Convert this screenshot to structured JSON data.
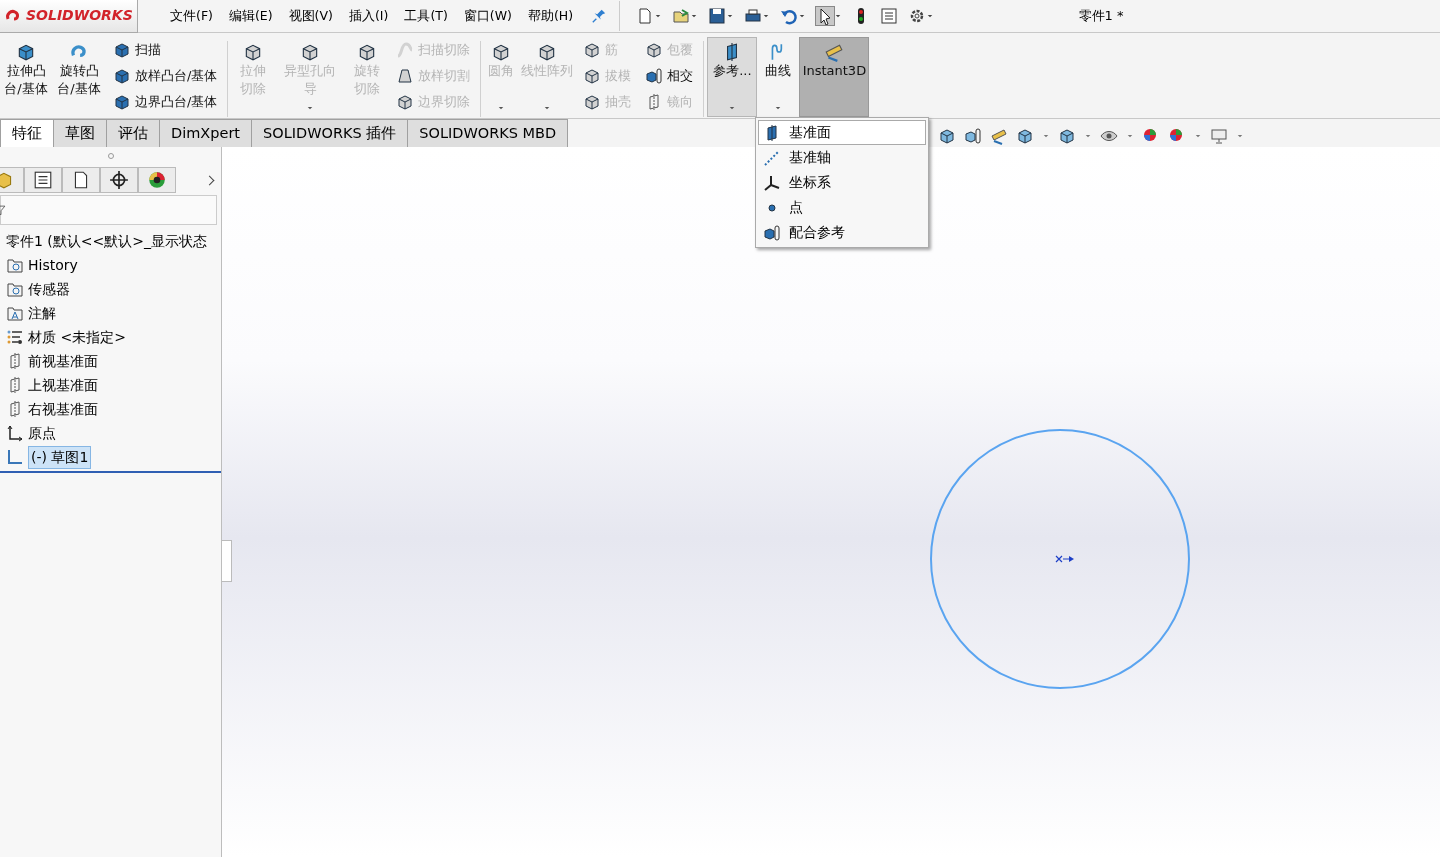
{
  "app": {
    "logo": "SOLIDWORKS",
    "title": "零件1 *"
  },
  "menu": [
    "文件(F)",
    "编辑(E)",
    "视图(V)",
    "插入(I)",
    "工具(T)",
    "窗口(W)",
    "帮助(H)"
  ],
  "ribbon": [
    {
      "kind": "large",
      "label": "拉伸凸台/基体",
      "disabled": false,
      "caret": false,
      "pressed": false
    },
    {
      "kind": "large",
      "label": "旋转凸台/基体",
      "disabled": false,
      "caret": false,
      "pressed": false
    },
    {
      "kind": "stack",
      "items": [
        {
          "label": "扫描",
          "disabled": false
        },
        {
          "label": "放样凸台/基体",
          "disabled": false
        },
        {
          "label": "边界凸台/基体",
          "disabled": false
        }
      ]
    },
    {
      "kind": "separator"
    },
    {
      "kind": "large",
      "label": "拉伸切除",
      "disabled": true,
      "caret": false,
      "pressed": false
    },
    {
      "kind": "large",
      "label": "异型孔向导",
      "disabled": true,
      "caret": true,
      "pressed": false
    },
    {
      "kind": "large",
      "label": "旋转切除",
      "disabled": true,
      "caret": false,
      "pressed": false
    },
    {
      "kind": "stack",
      "items": [
        {
          "label": "扫描切除",
          "disabled": true
        },
        {
          "label": "放样切割",
          "disabled": true
        },
        {
          "label": "边界切除",
          "disabled": true
        }
      ]
    },
    {
      "kind": "separator"
    },
    {
      "kind": "large",
      "label": "圆角",
      "disabled": true,
      "caret": true,
      "pressed": false
    },
    {
      "kind": "large",
      "label": "线性阵列",
      "disabled": true,
      "caret": true,
      "pressed": false
    },
    {
      "kind": "stack",
      "items": [
        {
          "label": "筋",
          "disabled": true
        },
        {
          "label": "拔模",
          "disabled": true
        },
        {
          "label": "抽壳",
          "disabled": true
        }
      ]
    },
    {
      "kind": "stack",
      "items": [
        {
          "label": "包覆",
          "disabled": true
        },
        {
          "label": "相交",
          "disabled": false
        },
        {
          "label": "镜向",
          "disabled": true
        }
      ]
    },
    {
      "kind": "separator"
    },
    {
      "kind": "large",
      "label": "参考...",
      "disabled": false,
      "caret": true,
      "pressed": true
    },
    {
      "kind": "large",
      "label": "曲线",
      "disabled": false,
      "caret": true,
      "pressed": false
    },
    {
      "kind": "large",
      "label": "Instant3D",
      "disabled": false,
      "caret": false,
      "pressed": true,
      "dark": true
    }
  ],
  "tabs": [
    {
      "label": "特征",
      "selected": true
    },
    {
      "label": "草图",
      "selected": false
    },
    {
      "label": "评估",
      "selected": false
    },
    {
      "label": "DimXpert",
      "selected": false
    },
    {
      "label": "SOLIDWORKS 插件",
      "selected": false
    },
    {
      "label": "SOLIDWORKS MBD",
      "selected": false
    }
  ],
  "tree": {
    "root": "零件1 (默认<<默认>_显示状态",
    "items": [
      {
        "label": "History",
        "selected": false
      },
      {
        "label": "传感器",
        "selected": false
      },
      {
        "label": "注解",
        "selected": false
      },
      {
        "label": "材质 <未指定>",
        "selected": false
      },
      {
        "label": "前视基准面",
        "selected": false
      },
      {
        "label": "上视基准面",
        "selected": false
      },
      {
        "label": "右视基准面",
        "selected": false
      },
      {
        "label": "原点",
        "selected": false
      },
      {
        "label": "(-) 草图1",
        "selected": true
      }
    ]
  },
  "reference_menu": [
    {
      "label": "基准面",
      "selected": true
    },
    {
      "label": "基准轴",
      "selected": false
    },
    {
      "label": "坐标系",
      "selected": false
    },
    {
      "label": "点",
      "selected": false
    },
    {
      "label": "配合参考",
      "selected": false
    }
  ]
}
